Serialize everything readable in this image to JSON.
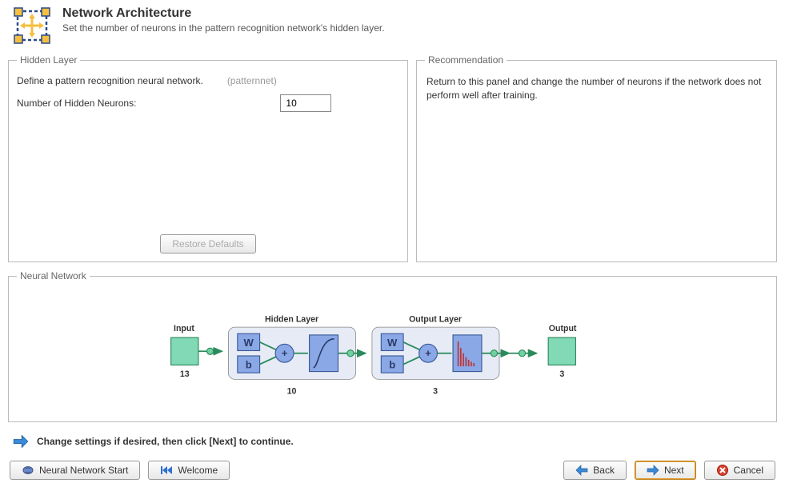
{
  "header": {
    "title": "Network Architecture",
    "subtitle": "Set the number of neurons in the pattern recognition network's hidden layer."
  },
  "hidden_layer": {
    "legend": "Hidden Layer",
    "define_text": "Define a pattern recognition neural network.",
    "func_name": "(patternnet)",
    "neurons_label": "Number of Hidden Neurons:",
    "neurons_value": "10",
    "restore_label": "Restore Defaults"
  },
  "recommendation": {
    "legend": "Recommendation",
    "text": "Return to this panel and change the number of neurons if the network does not perform well after training."
  },
  "neural": {
    "legend": "Neural Network",
    "input_label": "Input",
    "input_size": "13",
    "hidden_label": "Hidden Layer",
    "hidden_size": "10",
    "output_layer_label": "Output Layer",
    "output_layer_size": "3",
    "output_label": "Output",
    "output_size": "3",
    "W": "W",
    "b": "b",
    "plus": "+"
  },
  "hint": "Change settings if desired, then click [Next] to continue.",
  "footer": {
    "nn_start": "Neural Network Start",
    "welcome": "Welcome",
    "back": "Back",
    "next": "Next",
    "cancel": "Cancel"
  }
}
